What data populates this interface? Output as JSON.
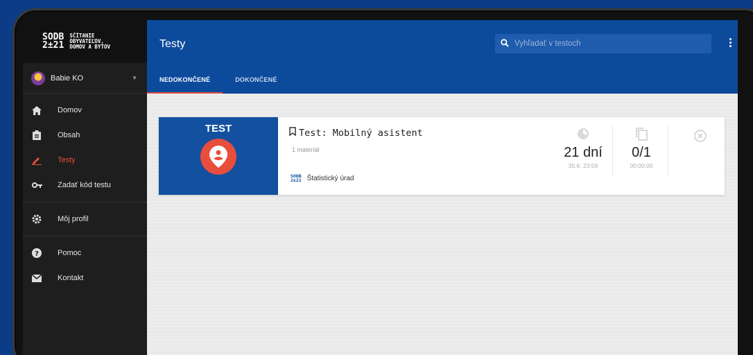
{
  "brand": {
    "logo_line1": "SODB",
    "logo_line2": "2±21",
    "text_line1": "SČÍTANIE",
    "text_line2": "OBYVATEĽOV,",
    "text_line3": "DOMOV A BYTOV"
  },
  "user": {
    "name": "Babie KO"
  },
  "sidebar": {
    "items": [
      {
        "label": "Domov",
        "icon": "home-icon"
      },
      {
        "label": "Obsah",
        "icon": "clipboard-icon"
      },
      {
        "label": "Testy",
        "icon": "pencil-icon",
        "active": true
      },
      {
        "label": "Zadať kód testu",
        "icon": "key-icon"
      },
      {
        "label": "Môj profil",
        "icon": "gear-icon"
      },
      {
        "label": "Pomoc",
        "icon": "help-icon"
      },
      {
        "label": "Kontakt",
        "icon": "mail-icon"
      }
    ]
  },
  "header": {
    "title": "Testy",
    "search_placeholder": "Vyhľadať v testoch",
    "tabs": [
      {
        "label": "NEDOKONČENÉ",
        "active": true
      },
      {
        "label": "DOKONČENÉ",
        "active": false
      }
    ]
  },
  "card": {
    "thumb_label": "TEST",
    "title": "Test: Mobilný asistent",
    "subtitle": "1 materiál",
    "org_logo_line1": "SODB",
    "org_logo_line2": "2±21",
    "org_name": "Štatistický úrad",
    "days_value": "21 dní",
    "days_sub": "30.6. 23:59",
    "attempts_value": "0/1",
    "attempts_sub": "00:00:00"
  },
  "colors": {
    "primary": "#0c4a9c",
    "accent": "#e94d3c",
    "sidebar": "#1e1e1e"
  }
}
